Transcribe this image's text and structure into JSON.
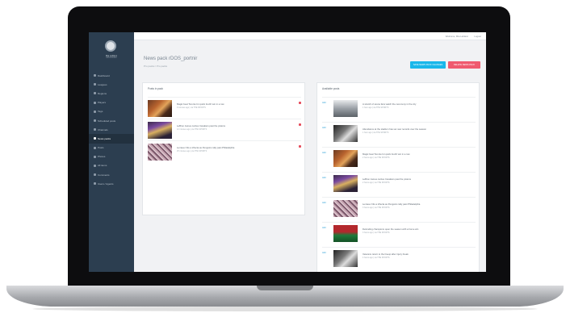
{
  "sidebar": {
    "user_name": "Mia Leblanc",
    "user_role": "Administrator",
    "items": [
      {
        "label": "Dashboard",
        "icon": "dashboard-icon"
      },
      {
        "label": "Leagues",
        "icon": "trophy-icon"
      },
      {
        "label": "Regions",
        "icon": "globe-icon"
      },
      {
        "label": "Players",
        "icon": "users-icon"
      },
      {
        "label": "Tags",
        "icon": "tag-icon"
      },
      {
        "label": "Scheduled posts",
        "icon": "clock-icon"
      },
      {
        "label": "Channels",
        "icon": "rss-icon"
      },
      {
        "label": "News packs",
        "icon": "layers-icon"
      },
      {
        "label": "Posts",
        "icon": "file-icon"
      },
      {
        "label": "Photos",
        "icon": "camera-icon"
      },
      {
        "label": "All items",
        "icon": "list-icon"
      },
      {
        "label": "Comments",
        "icon": "comment-icon"
      },
      {
        "label": "Users / Agents",
        "icon": "user-icon"
      }
    ]
  },
  "topbar": {
    "user": "Welcome, Mia Leblanc",
    "logout": "Logout"
  },
  "page": {
    "title": "News pack rDOS_portnir",
    "breadcrumb": "Pro packs  /  Pro packs"
  },
  "buttons": {
    "primary": "SAVE NEWS PACK CHANGES",
    "danger": "DELETE NEWS PACK"
  },
  "left_panel": {
    "title": "Posts in pack",
    "items": [
      {
        "title": "Magic beat Toronto for quick fourth win in a row",
        "meta": "9 minutes ago  |  via  THE SPORTS",
        "thumb": "court"
      },
      {
        "title": "LeBron James carries Cavaliers past the pistons",
        "meta": "12 minutes ago  |  via  THE SPORTS",
        "thumb": "player"
      },
      {
        "title": "Lemieux hits a trifecta as Penguins rally past Philadelphia",
        "meta": "25 minutes ago  |  via  THE SPORTS",
        "thumb": "crowd"
      }
    ]
  },
  "right_panel": {
    "title": "Available posts",
    "add_label": "Add",
    "items": [
      {
        "title": "A stretch of arena fans watch the ceremony in the city",
        "meta": "1 hour ago  |  via  THE SPORTS",
        "thumb": "gray"
      },
      {
        "title": "Attendance at the stadium has set new records over the season",
        "meta": "1 hour ago  |  via  THE SPORTS",
        "thumb": "bw"
      },
      {
        "title": "Magic beat Toronto for quick fourth win in a row",
        "meta": "2 hours ago  |  via  THE SPORTS",
        "thumb": "court"
      },
      {
        "title": "LeBron James carries Cavaliers past the pistons",
        "meta": "2 hours ago  |  via  THE SPORTS",
        "thumb": "player"
      },
      {
        "title": "Lemieux hits a trifecta as Penguins rally past Philadelphia",
        "meta": "3 hours ago  |  via  THE SPORTS",
        "thumb": "crowd"
      },
      {
        "title": "Defending champions open the season with a home win",
        "meta": "3 hours ago  |  via  THE SPORTS",
        "thumb": "green"
      },
      {
        "title": "Veterans return to the lineup after injury break",
        "meta": "4 hours ago  |  via  THE SPORTS",
        "thumb": "bw"
      }
    ]
  },
  "colors": {
    "sidebar": "#2c3e50",
    "primary_button": "#1ab7ea",
    "danger_button": "#ef5a6f"
  }
}
